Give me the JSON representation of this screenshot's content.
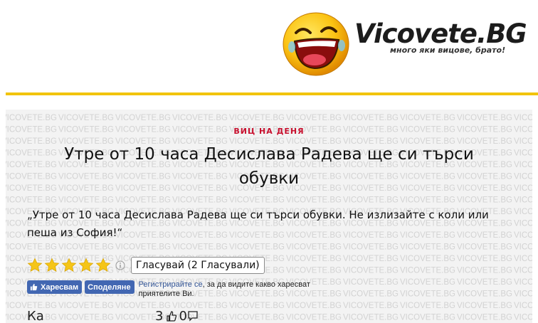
{
  "header": {
    "logo_text": "Vicovete.BG",
    "slogan": "много яки вицове, брато!"
  },
  "card": {
    "watermark_text": "VICOVETE.BG",
    "kicker": "ВИЦ НА ДЕНЯ",
    "title": "Утре от 10 часа Десислава Радева ще си търси обувки",
    "joke": "„Утре от 10 часа Десислава Радева ще си търси обувки. Не излизайте с коли или пеша из София!“",
    "rating": {
      "stars_filled": 5,
      "stars_total": 5
    },
    "vote_label": "Гласувай (2 Гласували)",
    "facebook": {
      "like_label": "Харесвам",
      "share_label": "Споделяне",
      "note_link": "Регистрирайте се",
      "note_rest": ", за да видите какво харесват приятелите Ви."
    },
    "bottom": {
      "label": "Ка",
      "count": "3",
      "comments": "0"
    }
  },
  "colors": {
    "accent_yellow": "#f2c40c",
    "kicker_red": "#c8102e",
    "star_gold": "#f5c518",
    "facebook_blue": "#4267b2"
  }
}
